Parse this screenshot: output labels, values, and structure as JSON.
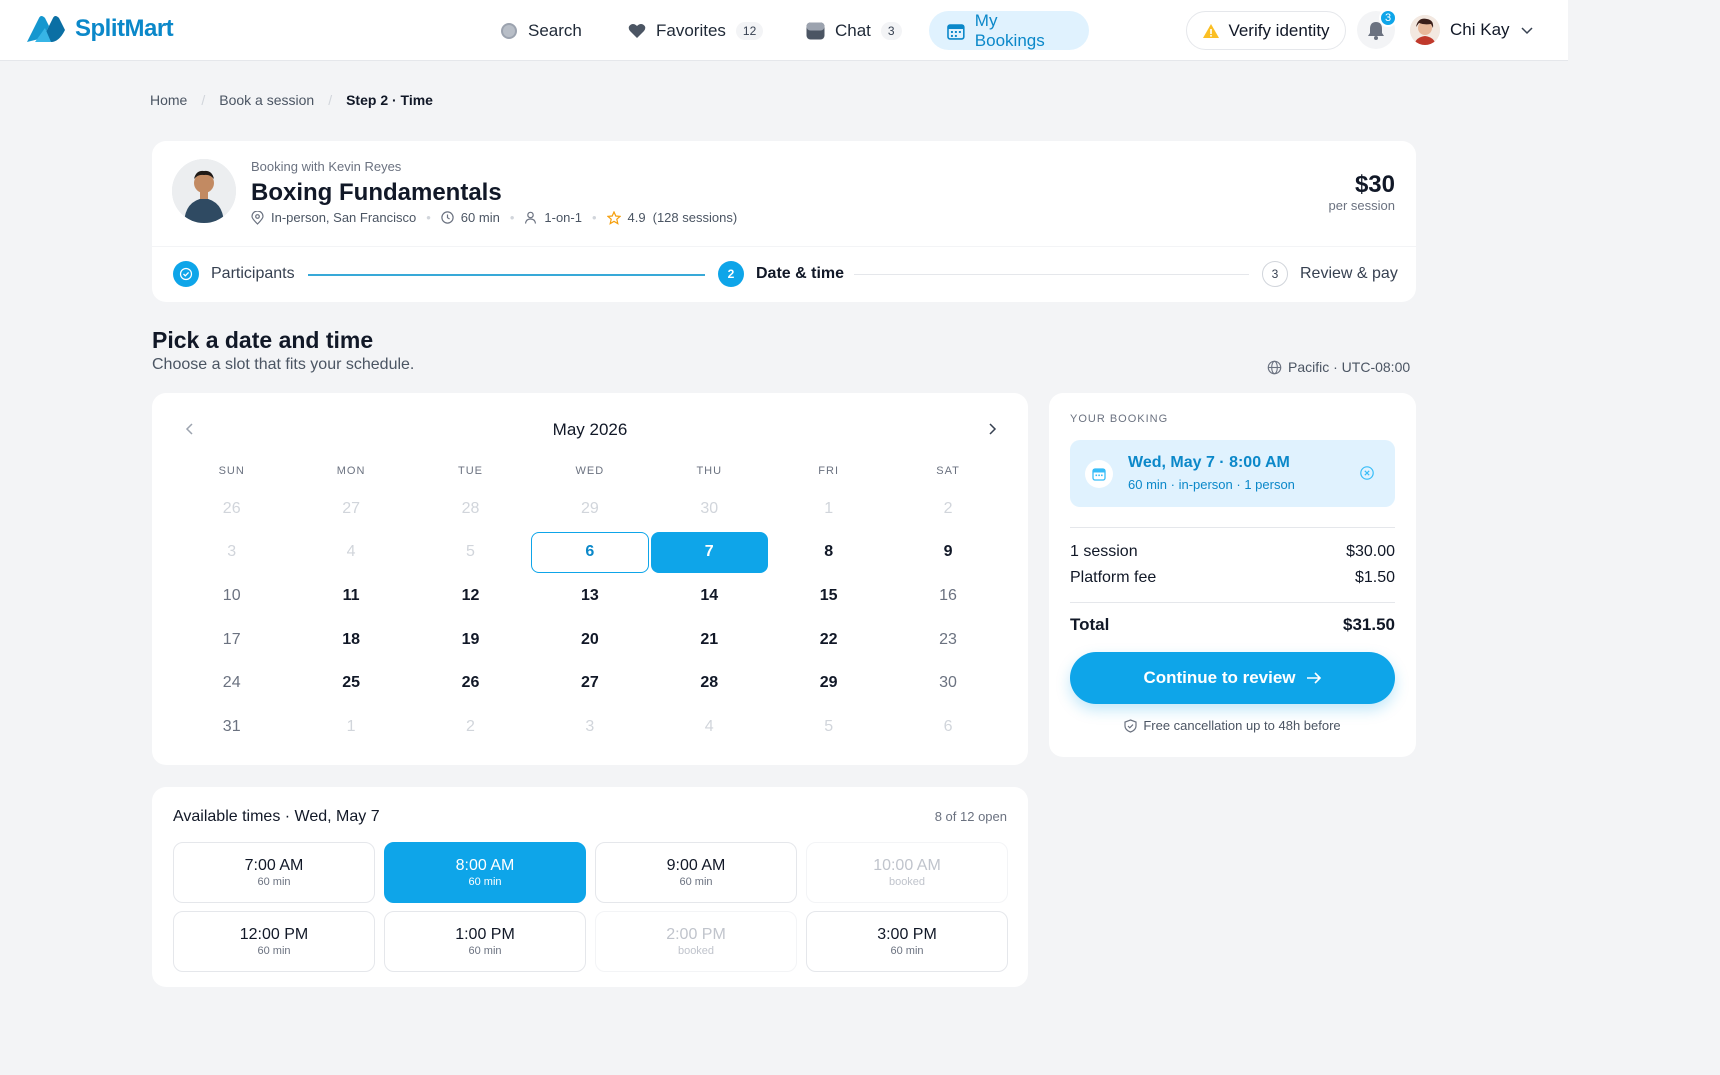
{
  "brand": {
    "name": "SplitMart",
    "accent": "#0ea5e9"
  },
  "nav": {
    "search_label": "Search",
    "favorites_label": "Favorites",
    "favorites_count": "12",
    "chat_label": "Chat",
    "chat_count": "3",
    "bookings_label": "My Bookings",
    "verify_label": "Verify identity",
    "notifications_count": "3",
    "user_name": "Chi Kay"
  },
  "breadcrumb": {
    "home": "Home",
    "book": "Book a session",
    "current": "Step 2 · Time"
  },
  "session": {
    "booking_with": "Booking with Kevin Reyes",
    "title": "Boxing Fundamentals",
    "location": "In-person, San Francisco",
    "duration": "60 min",
    "format": "1-on-1",
    "rating": "4.9",
    "sessions_count": "(128 sessions)",
    "price": "$30",
    "price_unit": "per session"
  },
  "steps": [
    {
      "number": "1",
      "label": "Participants",
      "state": "done"
    },
    {
      "number": "2",
      "label": "Date & time",
      "state": "current"
    },
    {
      "number": "3",
      "label": "Review & pay",
      "state": "upcoming"
    }
  ],
  "picker": {
    "title": "Pick a date and time",
    "subtitle": "Choose a slot that fits your schedule.",
    "timezone": "Pacific · UTC-08:00"
  },
  "calendar": {
    "month": "May 2026",
    "weekdays": [
      "SUN",
      "MON",
      "TUE",
      "WED",
      "THU",
      "FRI",
      "SAT"
    ],
    "days": [
      {
        "n": "26",
        "s": "muted"
      },
      {
        "n": "27",
        "s": "muted"
      },
      {
        "n": "28",
        "s": "muted"
      },
      {
        "n": "29",
        "s": "muted"
      },
      {
        "n": "30",
        "s": "muted"
      },
      {
        "n": "1",
        "s": "muted"
      },
      {
        "n": "2",
        "s": "muted"
      },
      {
        "n": "3",
        "s": "muted"
      },
      {
        "n": "4",
        "s": "muted"
      },
      {
        "n": "5",
        "s": "muted"
      },
      {
        "n": "6",
        "s": "today"
      },
      {
        "n": "7",
        "s": "selected"
      },
      {
        "n": "8",
        "s": "avail"
      },
      {
        "n": "9",
        "s": "avail"
      },
      {
        "n": "10",
        "s": "weekend"
      },
      {
        "n": "11",
        "s": "avail"
      },
      {
        "n": "12",
        "s": "avail"
      },
      {
        "n": "13",
        "s": "avail"
      },
      {
        "n": "14",
        "s": "avail"
      },
      {
        "n": "15",
        "s": "avail"
      },
      {
        "n": "16",
        "s": "weekend"
      },
      {
        "n": "17",
        "s": "weekend"
      },
      {
        "n": "18",
        "s": "avail"
      },
      {
        "n": "19",
        "s": "avail"
      },
      {
        "n": "20",
        "s": "avail"
      },
      {
        "n": "21",
        "s": "avail"
      },
      {
        "n": "22",
        "s": "avail"
      },
      {
        "n": "23",
        "s": "weekend"
      },
      {
        "n": "24",
        "s": "weekend"
      },
      {
        "n": "25",
        "s": "avail"
      },
      {
        "n": "26",
        "s": "avail"
      },
      {
        "n": "27",
        "s": "avail"
      },
      {
        "n": "28",
        "s": "avail"
      },
      {
        "n": "29",
        "s": "avail"
      },
      {
        "n": "30",
        "s": "weekend"
      },
      {
        "n": "31",
        "s": "weekend"
      },
      {
        "n": "1",
        "s": "muted"
      },
      {
        "n": "2",
        "s": "muted"
      },
      {
        "n": "3",
        "s": "muted"
      },
      {
        "n": "4",
        "s": "muted"
      },
      {
        "n": "5",
        "s": "muted"
      },
      {
        "n": "6",
        "s": "muted"
      }
    ]
  },
  "times": {
    "title": "Available times · Wed, May 7",
    "count": "8 of 12 open",
    "slots": [
      {
        "time": "7:00 AM",
        "sub": "60 min",
        "state": "open"
      },
      {
        "time": "8:00 AM",
        "sub": "60 min",
        "state": "selected"
      },
      {
        "time": "9:00 AM",
        "sub": "60 min",
        "state": "open"
      },
      {
        "time": "10:00 AM",
        "sub": "booked",
        "state": "booked"
      },
      {
        "time": "12:00 PM",
        "sub": "60 min",
        "state": "open"
      },
      {
        "time": "1:00 PM",
        "sub": "60 min",
        "state": "open"
      },
      {
        "time": "2:00 PM",
        "sub": "booked",
        "state": "booked"
      },
      {
        "time": "3:00 PM",
        "sub": "60 min",
        "state": "open"
      }
    ]
  },
  "summary": {
    "label": "YOUR BOOKING",
    "when": "Wed, May 7 · 8:00 AM",
    "detail": "60 min · in-person · 1 person",
    "line1_label": "1 session",
    "line1_value": "$30.00",
    "line2_label": "Platform fee",
    "line2_value": "$1.50",
    "total_label": "Total",
    "total_value": "$31.50",
    "cta": "Continue to review",
    "note": "Free cancellation up to 48h before"
  }
}
